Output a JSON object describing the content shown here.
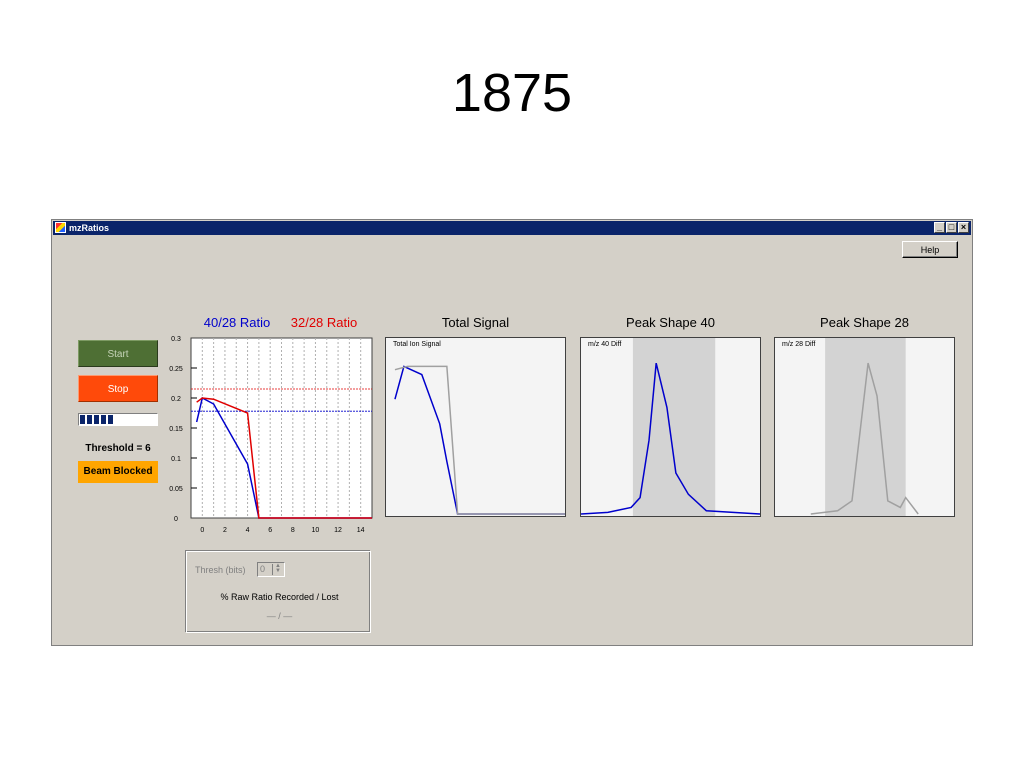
{
  "slide": {
    "title": "1875"
  },
  "window": {
    "title": "mzRatios",
    "buttons": {
      "minimize": "_",
      "maximize": "□",
      "close": "×"
    }
  },
  "toolbar": {
    "help_label": "Help"
  },
  "controls": {
    "start_label": "Start",
    "stop_label": "Stop",
    "progress_fraction": 0.45,
    "threshold_label": "Threshold = 6",
    "beam_status": "Beam Blocked"
  },
  "colors": {
    "ratio_40_28": "#0000cc",
    "ratio_32_28": "#e00000",
    "peak_gray": "#a0a0a0",
    "start": "#4e6f34",
    "stop": "#ff4a0a",
    "beam_badge": "#ffa500"
  },
  "thresh_group": {
    "thresh_label": "Thresh (bits)",
    "thresh_value": "0",
    "record_label": "% Raw Ratio Recorded / Lost",
    "record_value": "— / —"
  },
  "chart_data": [
    {
      "type": "line",
      "legend": [
        "40/28 Ratio",
        "32/28  Ratio"
      ],
      "ylim": [
        0,
        0.3
      ],
      "yticks": [
        "0",
        "0.05",
        "0.1",
        "0.15",
        "0.2",
        "0.25",
        "0.3"
      ],
      "xlim": [
        -1,
        15
      ],
      "xticks": [
        "0",
        "2",
        "4",
        "6",
        "8",
        "10",
        "12",
        "14"
      ],
      "grid": "vertical dashed",
      "series": [
        {
          "name": "40/28 Ratio",
          "x": [
            -0.5,
            0,
            1,
            4,
            5,
            15
          ],
          "y": [
            0.16,
            0.2,
            0.19,
            0.09,
            0,
            0
          ]
        },
        {
          "name": "32/28  Ratio",
          "x": [
            -0.5,
            0,
            1,
            4,
            5,
            15
          ],
          "y": [
            0.193,
            0.2,
            0.198,
            0.175,
            0,
            0
          ]
        }
      ],
      "reference_lines": [
        {
          "y": 0.215,
          "color": "#e00000"
        },
        {
          "y": 0.178,
          "color": "#0000cc"
        }
      ]
    },
    {
      "type": "line",
      "title": "Total Signal",
      "panel_label": "Total Ion Signal",
      "xlim": [
        0,
        10
      ],
      "ylim": [
        0,
        1
      ],
      "series": [
        {
          "x": [
            0.5,
            1,
            2,
            3,
            3.4,
            4,
            10
          ],
          "y": [
            0.7,
            0.9,
            0.85,
            0.55,
            0.32,
            0,
            0
          ],
          "color": "#0000cc"
        },
        {
          "x": [
            0.5,
            1.2,
            3.4,
            4,
            10
          ],
          "y": [
            0.88,
            0.9,
            0.9,
            0.0,
            0
          ],
          "color": "#a0a0a0"
        }
      ]
    },
    {
      "type": "line",
      "title": "Peak Shape 40",
      "panel_label": "m/z 40 Diff",
      "xlim": [
        0,
        10
      ],
      "ylim": [
        0,
        1
      ],
      "shaded_region": [
        2.9,
        7.5
      ],
      "series": [
        {
          "x": [
            0,
            1.5,
            2.8,
            3.3,
            3.8,
            4.2,
            4.8,
            5.3,
            6.0,
            7.0,
            10
          ],
          "y": [
            0,
            0.01,
            0.04,
            0.1,
            0.45,
            0.92,
            0.65,
            0.25,
            0.12,
            0.02,
            0
          ],
          "color": "#0000cc"
        }
      ]
    },
    {
      "type": "line",
      "title": "Peak Shape 28",
      "panel_label": "m/z 28 Diff",
      "xlim": [
        0,
        10
      ],
      "ylim": [
        0,
        1
      ],
      "shaded_region": [
        2.8,
        7.3
      ],
      "series": [
        {
          "x": [
            2,
            3.5,
            4.3,
            5.2,
            5.7,
            6.3,
            7.0,
            7.3,
            8.0
          ],
          "y": [
            0,
            0.02,
            0.08,
            0.92,
            0.72,
            0.08,
            0.04,
            0.1,
            0
          ],
          "color": "#a0a0a0"
        }
      ]
    }
  ]
}
